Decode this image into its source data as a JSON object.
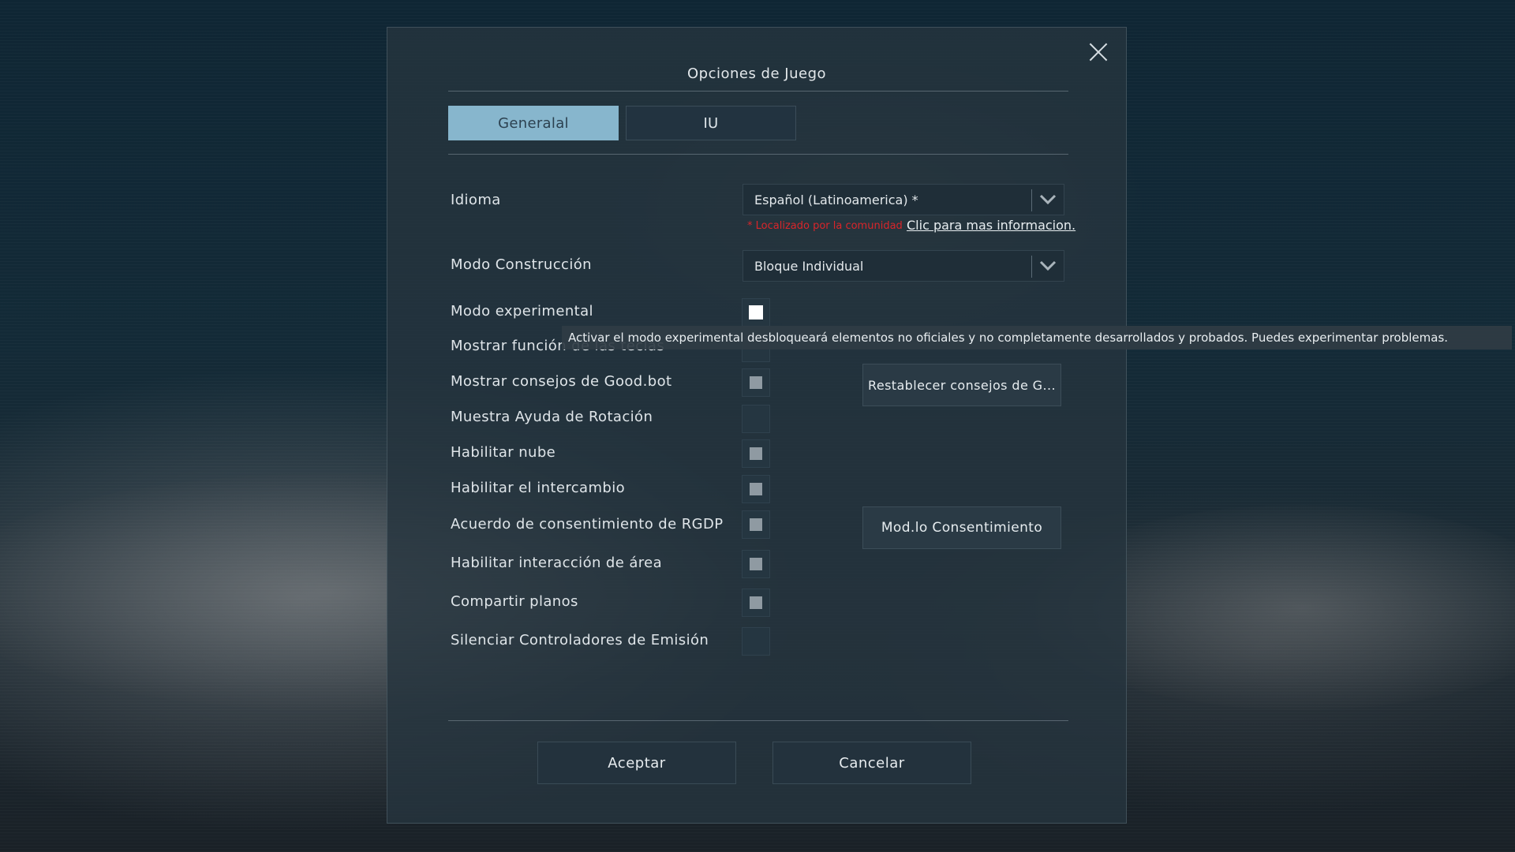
{
  "dialog": {
    "title": "Opciones de Juego",
    "close_icon": "close-icon"
  },
  "tabs": [
    {
      "label": "Generalal",
      "active": true
    },
    {
      "label": "IU",
      "active": false
    }
  ],
  "options": {
    "language": {
      "label": "Idioma",
      "value": "Español (Latinoamerica) *",
      "note": "* Localizado por la comunidad",
      "link": "Clic para mas informacion."
    },
    "build_mode": {
      "label": "Modo Construcción",
      "value": "Bloque Individual"
    },
    "experimental": {
      "label": "Modo experimental",
      "state": "checked"
    },
    "show_key_function": {
      "label": "Mostrar función de las teclas",
      "state": "empty"
    },
    "goodbot_tips": {
      "label": "Mostrar consejos de Good.bot",
      "state": "checked"
    },
    "rotation_help": {
      "label": "Muestra Ayuda de Rotación",
      "state": "empty"
    },
    "enable_cloud": {
      "label": "Habilitar  nube",
      "state": "checked"
    },
    "enable_trade": {
      "label": "Habilitar el intercambio",
      "state": "checked"
    },
    "gdpr": {
      "label": "Acuerdo de consentimiento de RGDP",
      "state": "checked"
    },
    "area_interaction": {
      "label": "Habilitar interacción de área",
      "state": "checked"
    },
    "share_blueprints": {
      "label": "Compartir planos",
      "state": "checked"
    },
    "mute_emission": {
      "label": "Silenciar Controladores de Emisión",
      "state": "empty"
    }
  },
  "buttons": {
    "reset_tips": "Restablecer consejos de G...",
    "modify_consent": "Mod.lo Consentimiento",
    "accept": "Aceptar",
    "cancel": "Cancelar"
  },
  "tooltip": "Activar el modo experimental desbloqueará elementos no oficiales y no completamente desarrollados y probados. Puedes experimentar problemas.",
  "colors": {
    "active_tab": "#87b6cd",
    "note_red": "#d9252a",
    "dialog_bg": "#26343e"
  }
}
